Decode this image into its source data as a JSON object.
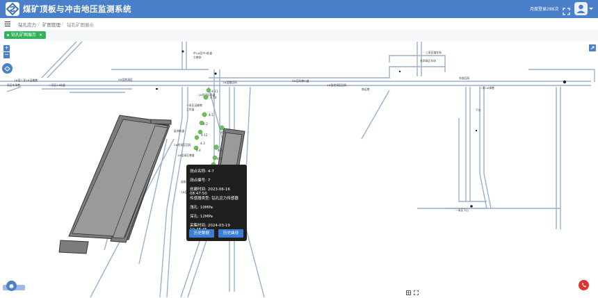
{
  "header": {
    "app_title": "煤矿顶板与冲击地压监测系统",
    "login_count": "月度登录286次",
    "colors": {
      "header_bg": "#4a7fc9",
      "tag_green": "#34b15b",
      "alarm_red": "#e0322e"
    }
  },
  "breadcrumb": [
    "钻孔应力",
    "矿图管理",
    "钻孔矿图展示"
  ],
  "tab": {
    "label": "钻孔矿图展示"
  },
  "map": {
    "labels": [
      "中1#层中1轨道",
      "大巷修",
      "东四采区车场",
      "三采区煤车场",
      "1#层二采1#运输巷",
      "采区车场巷",
      "二采区14轨道",
      "4#层前采区",
      "1#层路回风",
      "3#回风巷口道",
      "1#层综采区回风",
      "南运巷",
      "1#综采区轨道",
      "延伸轨道",
      "东部回风",
      "二采1#煤巷",
      "下仓",
      "一采区下山",
      "一采区运输巷",
      "工作面",
      "2#综采区回风",
      "1#层采区巷道",
      "连接巷",
      "东部运输巷",
      "1#层运输巷"
    ],
    "points": [
      "4-1",
      "4-2",
      "4-3",
      "4-4",
      "4-5",
      "4-6",
      "4-7",
      "4-8",
      "4-10",
      "4-11",
      "4-12"
    ]
  },
  "popup": {
    "rows": [
      {
        "label": "测点名称:",
        "value": "4-7"
      },
      {
        "label": "测点编号:",
        "value": "7"
      },
      {
        "label": "创建时间:",
        "value": "2023-06-16 08:47:50"
      },
      {
        "label": "传感器类型:",
        "value": "钻孔应力传感器"
      },
      {
        "label": "浅孔:",
        "value": "10MPa"
      },
      {
        "label": "深孔:",
        "value": "12MPa"
      },
      {
        "label": "采集时间:",
        "value": "2024-03-19 10:48:45"
      }
    ],
    "btn_history_data": "历史数据",
    "btn_history_curve": "历史曲线"
  }
}
